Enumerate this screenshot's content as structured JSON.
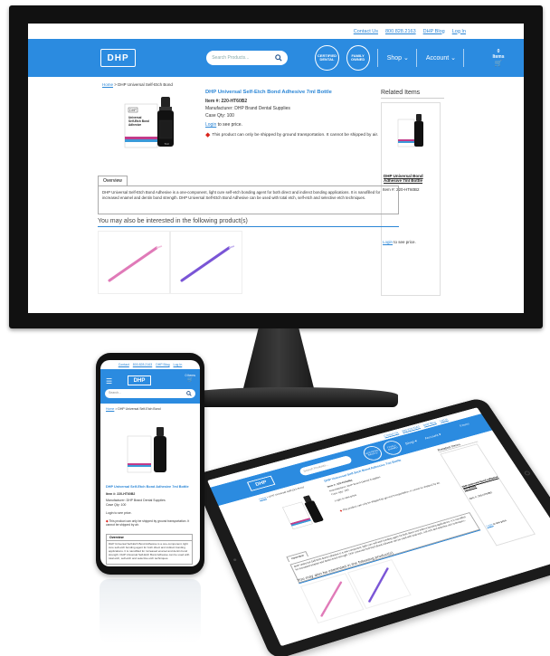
{
  "site": {
    "top_links": [
      "Contact Us",
      "800.828.2163",
      "DHP Blog",
      "Log In"
    ],
    "logo": "DHP",
    "search_placeholder": "Search Products...",
    "badge_1": "CERTIFIED DENTAL",
    "badge_2": "FAMILY OWNED",
    "menu_shop": "Shop",
    "menu_account": "Account",
    "cart_label": "0 Items"
  },
  "breadcrumb": {
    "home": "Home",
    "current": " > DHP Universal Self-Etch Bond"
  },
  "product": {
    "title": "DHP Universal Self-Etch Bond Adhesive 7ml Bottle",
    "item_no": "Item #: 220-HT60B2",
    "manufacturer": "Manufacturer: DHP Brand Dental Supplies",
    "case_qty": "Case Qty: 100",
    "login_link": "Login",
    "login_text": " to see price.",
    "warning": "This product can only be shipped by ground transportation. It cannot be shipped by air.",
    "image_label_brand": "DHP",
    "image_label_line1": "Universal",
    "image_label_line2": "Self-Etch Bond",
    "image_label_line3": "Adhesive",
    "image_size": "7ml"
  },
  "related": {
    "title": "Related Items",
    "name": "DHP Universal Bond Adhesive 7ml Bottle",
    "item_no": "Item #: 220-HT60B2",
    "login_link": "Login",
    "login_text": " to see price."
  },
  "overview": {
    "tab": "Overview",
    "body": "DHP Universal Self-Etch Bond Adhesive is a one-component, light cure self-etch bonding agent for both direct and indirect bonding applications. It is nanofilled for increased enamel and dentin bond strength. DHP Universal Self-Etch Bond Adhesive can be used with total etch, self-etch and selective etch techniques."
  },
  "also": {
    "title": "You may also be interested in the following product(s)"
  },
  "phone": {
    "top_links": [
      "Contact",
      "800.828.2163",
      "DHP Blog",
      "Log In"
    ],
    "menu_icon": "☰",
    "cart": "0 Items",
    "search": "Search...",
    "breadcrumb_home": "Home",
    "breadcrumb_rest": " > DHP Universal Self-Etch Bond",
    "title": "DHP Universal Self-Etch Bond Adhesive 7ml Bottle",
    "item_no": "Item #: 220-HT60B2",
    "manufacturer": "Manufacturer: DHP Brand Dental Supplies",
    "case_qty": "Case Qty: 100",
    "login": "Login to see price.",
    "warning": "This product can only be shipped by ground transportation. It cannot be shipped by air.",
    "overview_tab": "Overview",
    "overview_body": "DHP Universal Self-Etch Bond Adhesive is a one-component, light cure self-etch bonding agent for both direct and indirect bonding applications. It is nanofilled for increased enamel and dentin bond strength. DHP Universal Self-Etch Bond Adhesive can be used with total etch, self-etch and selective etch techniques."
  },
  "tablet": {
    "top_links": [
      "Contact Us",
      "800.828.2163",
      "DHP Blog",
      "Log In"
    ],
    "search": "Search Products...",
    "badge_1": "CERTIFIED DENTAL",
    "badge_2": "FAMILY OWNED",
    "menu_shop": "Shop ▾",
    "menu_account": "Account ▾",
    "cart": "0 Items",
    "breadcrumb_home": "Home",
    "breadcrumb_rest": " > DHP Universal Self-Etch Bond",
    "title": "DHP Universal Self-Etch Bond Adhesive 7ml Bottle",
    "item_no": "Item #: 220-HT60B2",
    "manufacturer": "Manufacturer: DHP Brand Dental Supplies",
    "case_qty": "Case Qty: 100",
    "login": "Login to see price.",
    "warning": "This product can only be shipped by ground transportation. It cannot be shipped by air.",
    "related_title": "Related Items",
    "related_name": "DHP Universal Bond Adhesive 7ml Bottle",
    "related_item": "Item #: 220-HT60B2",
    "related_login_link": "Login",
    "related_login_text": " to see price.",
    "overview_tab": "Overview",
    "overview_body": "DHP Universal Self-Etch Bond Adhesive is a one-component, light cure self-etch bonding agent for both direct and indirect bonding applications. It is nanofilled for increased enamel and dentin bond strength. DHP Universal Self-Etch Bond Adhesive can be used with total etch, self-etch and selective etch techniques.",
    "also_title": "You may also be interested in the following product(s)"
  },
  "colors": {
    "brand_blue": "#2b8be0",
    "link_blue": "#2b86d6",
    "warning_red": "#d9241c",
    "device_black": "#111111"
  }
}
